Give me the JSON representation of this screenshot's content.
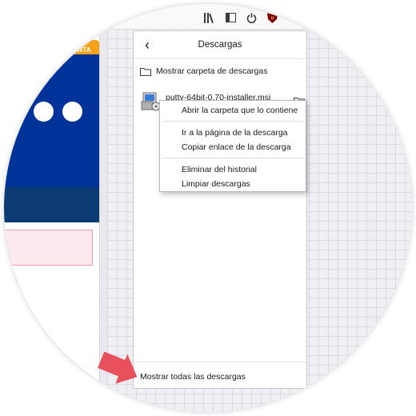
{
  "webpage": {
    "orange_button_label": "NTA",
    "colors": {
      "blue": "#003399",
      "dark_band": "#0c3a73",
      "orange": "#f6a21a",
      "pink_box": "#fbe9ee"
    }
  },
  "toolbar": {
    "icons": [
      "library-icon",
      "sidebar-icon",
      "power-icon",
      "ublock-icon"
    ]
  },
  "downloads_panel": {
    "title": "Descargas",
    "back_label": "‹",
    "show_folder_label": "Mostrar carpeta de descargas",
    "items": [
      {
        "filename": "putty-64bit-0.70-installer.msi"
      }
    ],
    "footer_label": "Mostrar todas las descargas"
  },
  "context_menu": {
    "items": [
      {
        "label": "Abrir la carpeta que lo contiene"
      },
      {
        "label": "Ir a la página de la descarga"
      },
      {
        "label": "Copiar enlace de la descarga"
      },
      {
        "label": "Eliminar del historial"
      },
      {
        "label": "Limpiar descargas"
      }
    ]
  },
  "annotation": {
    "arrow_color": "#e8505b"
  }
}
